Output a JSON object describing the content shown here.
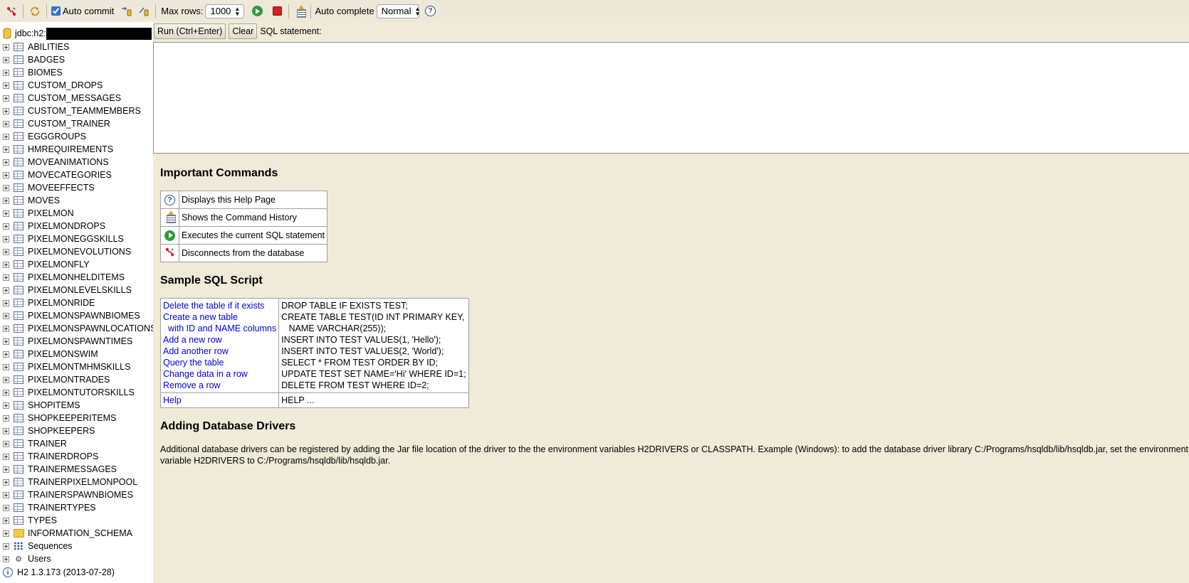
{
  "toolbar": {
    "auto_commit_label": "Auto commit",
    "max_rows_label": "Max rows:",
    "max_rows_value": "1000",
    "auto_complete_label": "Auto complete",
    "auto_complete_value": "Normal"
  },
  "sidebar": {
    "connection": "jdbc:h2:",
    "tables": [
      "ABILITIES",
      "BADGES",
      "BIOMES",
      "CUSTOM_DROPS",
      "CUSTOM_MESSAGES",
      "CUSTOM_TEAMMEMBERS",
      "CUSTOM_TRAINER",
      "EGGGROUPS",
      "HMREQUIREMENTS",
      "MOVEANIMATIONS",
      "MOVECATEGORIES",
      "MOVEEFFECTS",
      "MOVES",
      "PIXELMON",
      "PIXELMONDROPS",
      "PIXELMONEGGSKILLS",
      "PIXELMONEVOLUTIONS",
      "PIXELMONFLY",
      "PIXELMONHELDITEMS",
      "PIXELMONLEVELSKILLS",
      "PIXELMONRIDE",
      "PIXELMONSPAWNBIOMES",
      "PIXELMONSPAWNLOCATIONS",
      "PIXELMONSPAWNTIMES",
      "PIXELMONSWIM",
      "PIXELMONTMHMSKILLS",
      "PIXELMONTRADES",
      "PIXELMONTUTORSKILLS",
      "SHOPITEMS",
      "SHOPKEEPERITEMS",
      "SHOPKEEPERS",
      "TRAINER",
      "TRAINERDROPS",
      "TRAINERMESSAGES",
      "TRAINERPIXELMONPOOL",
      "TRAINERSPAWNBIOMES",
      "TRAINERTYPES",
      "TYPES"
    ],
    "schema": "INFORMATION_SCHEMA",
    "sequences": "Sequences",
    "users": "Users",
    "version": "H2 1.3.173 (2013-07-28)"
  },
  "query": {
    "run_label": "Run (Ctrl+Enter)",
    "clear_label": "Clear",
    "sql_label": "SQL statement:",
    "sql_value": ""
  },
  "help": {
    "important_title": "Important Commands",
    "commands": [
      {
        "icon": "help-icon",
        "text": "Displays this Help Page"
      },
      {
        "icon": "history-icon",
        "text": "Shows the Command History"
      },
      {
        "icon": "run-icon",
        "text": "Executes the current SQL statement"
      },
      {
        "icon": "disconnect-icon",
        "text": "Disconnects from the database"
      }
    ],
    "sample_title": "Sample SQL Script",
    "sample_links": [
      "Delete the table if it exists",
      "Create a new table",
      "  with ID and NAME columns",
      "Add a new row",
      "Add another row",
      "Query the table",
      "Change data in a row",
      "Remove a row"
    ],
    "sample_sql": [
      "DROP TABLE IF EXISTS TEST;",
      "CREATE TABLE TEST(ID INT PRIMARY KEY,",
      "   NAME VARCHAR(255));",
      "INSERT INTO TEST VALUES(1, 'Hello');",
      "INSERT INTO TEST VALUES(2, 'World');",
      "SELECT * FROM TEST ORDER BY ID;",
      "UPDATE TEST SET NAME='Hi' WHERE ID=1;",
      "DELETE FROM TEST WHERE ID=2;"
    ],
    "help_link": "Help",
    "help_sql": "HELP ...",
    "drivers_title": "Adding Database Drivers",
    "drivers_text": "Additional database drivers can be registered by adding the Jar file location of the driver to the the environment variables H2DRIVERS or CLASSPATH. Example (Windows): to add the database driver library C:/Programs/hsqldb/lib/hsqldb.jar, set the environment variable H2DRIVERS to C:/Programs/hsqldb/lib/hsqldb.jar."
  }
}
